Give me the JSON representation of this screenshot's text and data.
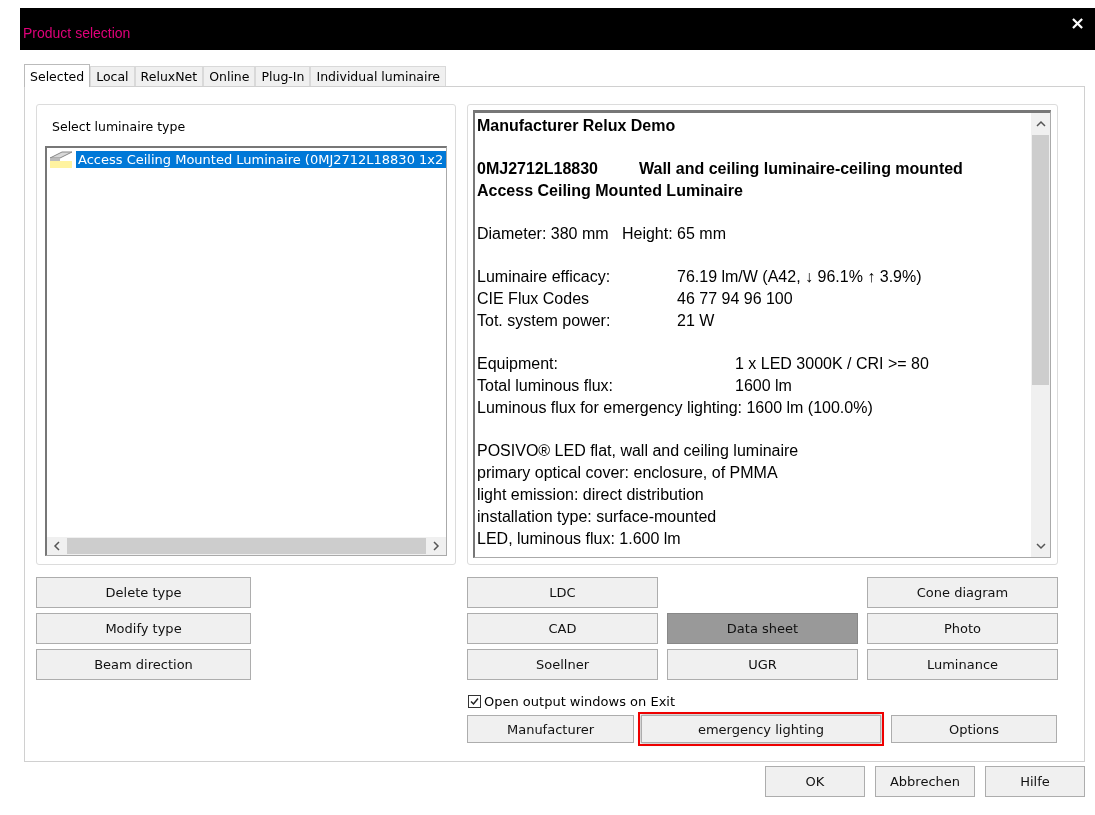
{
  "window": {
    "title": "Product selection",
    "close": "×"
  },
  "tabs": [
    {
      "label": "Selected",
      "selected": true
    },
    {
      "label": "Local",
      "selected": false
    },
    {
      "label": "ReluxNet",
      "selected": false
    },
    {
      "label": "Online",
      "selected": false
    },
    {
      "label": "Plug-In",
      "selected": false
    },
    {
      "label": "Individual luminaire",
      "selected": false
    }
  ],
  "luminaire_list": {
    "label": "Select luminaire type",
    "items": [
      {
        "text": "Access Ceiling Mounted Luminaire (0MJ2712L18830 1x2",
        "selected": true
      }
    ]
  },
  "data_sheet": {
    "sections": [
      {
        "kind": "heading",
        "lines": [
          {
            "text": "Manufacturer Relux Demo"
          }
        ]
      },
      {
        "kind": "heading",
        "lines": [
          {
            "label": "0MJ2712L18830",
            "value": "Wall and ceiling luminaire-ceiling mounted"
          },
          {
            "text": "Access Ceiling Mounted Luminaire"
          }
        ]
      },
      {
        "kind": "plain",
        "lines": [
          {
            "text": "Diameter: 380 mm   Height: 65 mm"
          }
        ]
      },
      {
        "kind": "specs",
        "lines": [
          {
            "label": "Luminaire efficacy:",
            "value": "76.19 lm/W (A42, ↓ 96.1% ↑ 3.9%)"
          },
          {
            "label": "CIE Flux Codes",
            "value": "46 77 94 96 100"
          },
          {
            "label": "Tot. system power:",
            "value": "21 W"
          }
        ]
      },
      {
        "kind": "equipment",
        "lines": [
          {
            "label": "Equipment:",
            "value": "1 x LED 3000K / CRI >= 80"
          },
          {
            "label": "Total luminous flux:",
            "value": "1600 lm"
          },
          {
            "text": "Luminous flux for emergency lighting: 1600 lm (100.0%)"
          }
        ]
      },
      {
        "kind": "plain",
        "lines": [
          {
            "text": "POSIVO® LED flat, wall and ceiling luminaire"
          },
          {
            "text": "primary optical cover: enclosure, of PMMA"
          },
          {
            "text": "light emission: direct distribution"
          },
          {
            "text": "installation type: surface-mounted"
          },
          {
            "text": "LED, luminous flux: 1.600 lm"
          }
        ]
      }
    ]
  },
  "type_buttons": [
    {
      "label": "Delete type"
    },
    {
      "label": "Modify type"
    },
    {
      "label": "Beam direction"
    }
  ],
  "output_buttons": [
    [
      {
        "label": "LDC",
        "pressed": false
      },
      {
        "label": "CAD",
        "pressed": false
      },
      {
        "label": "Soellner",
        "pressed": false
      }
    ],
    [
      {
        "label": "Data sheet",
        "pressed": true
      },
      {
        "label": "UGR",
        "pressed": false
      }
    ],
    [
      {
        "label": "Cone diagram",
        "pressed": false
      },
      {
        "label": "Photo",
        "pressed": false
      },
      {
        "label": "Luminance",
        "pressed": false
      }
    ]
  ],
  "open_output_on_exit": {
    "label": "Open output windows on Exit",
    "checked": true
  },
  "extra_buttons": [
    {
      "label": "Manufacturer",
      "highlighted": false
    },
    {
      "label": "emergency lighting",
      "highlighted": true
    },
    {
      "label": "Options",
      "highlighted": false
    }
  ],
  "dialog_buttons": [
    {
      "label": "OK"
    },
    {
      "label": "Abbrechen"
    },
    {
      "label": "Hilfe"
    }
  ]
}
